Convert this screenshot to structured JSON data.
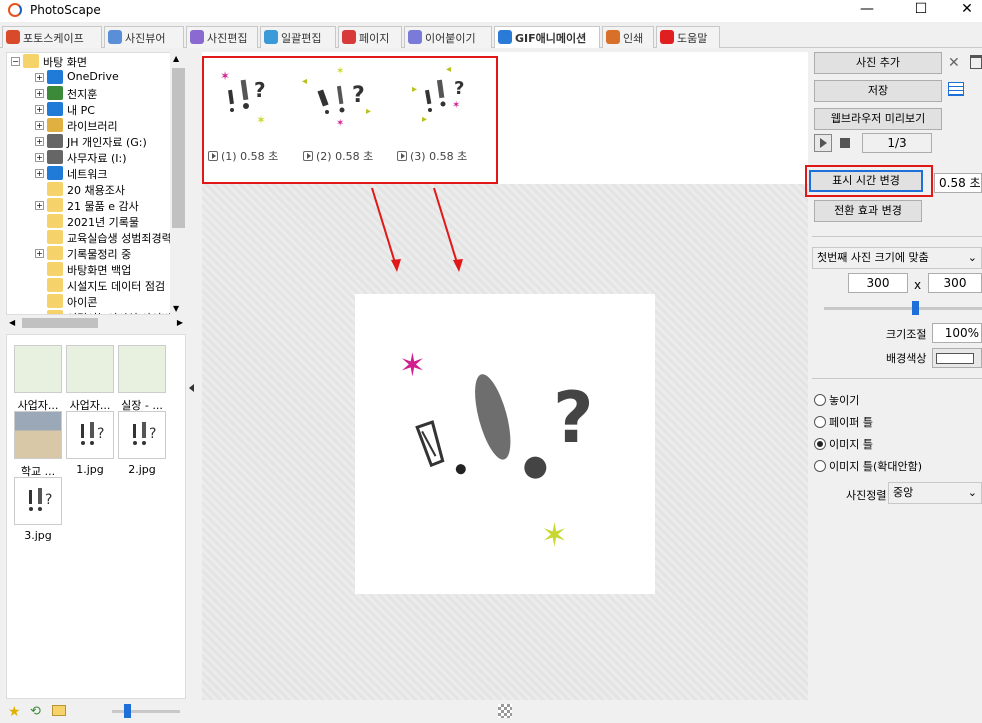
{
  "window": {
    "title": "PhotoScape",
    "minimize": "—",
    "maximize": "☐",
    "close": "✕"
  },
  "tabs": [
    {
      "label": "포토스케이프",
      "color": "#d84a2a"
    },
    {
      "label": "사진뷰어",
      "color": "#5a8fd8"
    },
    {
      "label": "사진편집",
      "color": "#8a6ad0"
    },
    {
      "label": "일괄편집",
      "color": "#3a9ad8"
    },
    {
      "label": "페이지",
      "color": "#d83a3a"
    },
    {
      "label": "이어붙이기",
      "color": "#7a7ad8"
    },
    {
      "label": "GIF애니메이션",
      "color": "#2a7ad8"
    },
    {
      "label": "인쇄",
      "color": "#d8702a"
    },
    {
      "label": "도움말",
      "color": "#e02020"
    }
  ],
  "tree": {
    "root": "바탕 화면",
    "items": [
      {
        "label": "OneDrive",
        "icon": "cloud",
        "color": "#1f7ad8"
      },
      {
        "label": "천지훈",
        "icon": "user",
        "color": "#3a8a3a"
      },
      {
        "label": "내 PC",
        "icon": "pc",
        "color": "#1f7ad8"
      },
      {
        "label": "라이브러리",
        "icon": "library",
        "color": "#e0b040"
      },
      {
        "label": "JH 개인자료 (G:)",
        "icon": "drive",
        "color": "#666"
      },
      {
        "label": "사무자료 (I:)",
        "icon": "drive",
        "color": "#666"
      },
      {
        "label": "네트워크",
        "icon": "network",
        "color": "#1f7ad8"
      },
      {
        "label": "20 채용조사",
        "icon": "folder",
        "color": "#f5d36a"
      },
      {
        "label": "21 물품 e 감사",
        "icon": "folder",
        "color": "#f5d36a"
      },
      {
        "label": "2021년 기록물",
        "icon": "folder",
        "color": "#f5d36a"
      },
      {
        "label": "교육실습생 성범죄경력",
        "icon": "folder",
        "color": "#f5d36a"
      },
      {
        "label": "기록물정리 중",
        "icon": "folder",
        "color": "#f5d36a"
      },
      {
        "label": "바탕화면 백업",
        "icon": "folder",
        "color": "#f5d36a"
      },
      {
        "label": "시설지도 데이터 점검",
        "icon": "folder",
        "color": "#f5d36a"
      },
      {
        "label": "아이콘",
        "icon": "folder",
        "color": "#f5d36a"
      },
      {
        "label": "어린이놀이시설 사이버",
        "icon": "folder",
        "color": "#f5d36a"
      }
    ]
  },
  "thumbnails": [
    {
      "label": "사업자...",
      "kind": "doc"
    },
    {
      "label": "사업자...",
      "kind": "doc"
    },
    {
      "label": "실장 - ...",
      "kind": "doc"
    },
    {
      "label": "학교 ...",
      "kind": "photo"
    },
    {
      "label": "1.jpg",
      "kind": "sticker"
    },
    {
      "label": "2.jpg",
      "kind": "sticker"
    },
    {
      "label": "3.jpg",
      "kind": "sticker"
    }
  ],
  "frames": [
    {
      "label": "(1) 0.58 초"
    },
    {
      "label": "(2) 0.58 초"
    },
    {
      "label": "(3) 0.58 초"
    }
  ],
  "right_panel": {
    "add_photo": "사진 추가",
    "save": "저장",
    "browser_preview": "웹브라우저 미리보기",
    "frame_counter": "1/3",
    "change_display_time": "표시 시간 변경",
    "display_time_value": "0.58 초",
    "change_transition": "전환 효과 변경",
    "size_mode": "첫번째 사진 크기에 맞춤",
    "width": "300",
    "height": "300",
    "size_x": "x",
    "resize_label": "크기조절",
    "resize_value": "100%",
    "bg_color_label": "배경색상",
    "placement_options": [
      {
        "label": "놓이기",
        "selected": false
      },
      {
        "label": "페이퍼 틀",
        "selected": false
      },
      {
        "label": "이미지 틀",
        "selected": true
      },
      {
        "label": "이미지 틀(확대안함)",
        "selected": false
      }
    ],
    "align_label": "사진정렬",
    "align_value": "중앙"
  },
  "accent": {
    "highlight": "#e01818",
    "selected_border": "#1f6fd8"
  }
}
